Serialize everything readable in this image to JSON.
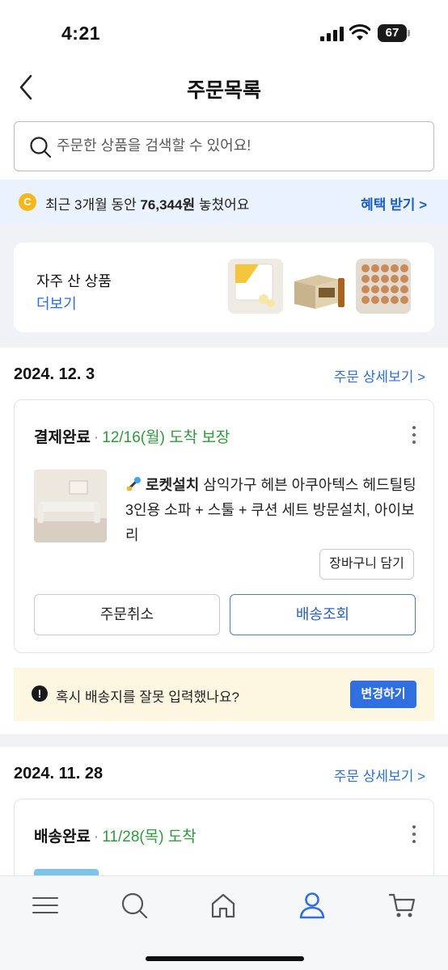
{
  "status_bar": {
    "time": "4:21",
    "battery": "67"
  },
  "header": {
    "title": "주문목록"
  },
  "search": {
    "placeholder": "주문한 상품을 검색할 수 있어요!"
  },
  "savings": {
    "coin_label": "C",
    "prefix": "최근 3개월 동안 ",
    "amount": "76,344원",
    "suffix": " 놓쳤어요",
    "link": "혜택 받기 >"
  },
  "frequent": {
    "title": "자주 산 상품",
    "more": "더보기"
  },
  "orders": [
    {
      "date": "2024. 12. 3",
      "detail_link": "주문 상세보기 >",
      "status": "결제완료",
      "delivery": "12/16(월) 도착 보장",
      "badge": "로켓설치",
      "product": "삼익가구 헤븐 아쿠아텍스 헤드틸팅 3인용 소파 + 스툴 + 쿠션 세트 방문설치, 아이보리",
      "cart_button": "장바구니 담기",
      "cancel_button": "주문취소",
      "track_button": "배송조회"
    },
    {
      "date": "2024. 11. 28",
      "detail_link": "주문 상세보기 >",
      "status": "배송완료",
      "delivery": "11/28(목) 도착"
    }
  ],
  "warning": {
    "icon": "!",
    "text": "혹시 배송지를 잘못 입력했나요?",
    "button": "변경하기"
  },
  "colors": {
    "accent": "#2f6fe0",
    "link": "#2a6fd6",
    "green": "#2f9a3c",
    "savings_bg": "#eaf3fd",
    "warning_bg": "#fdf7e2"
  },
  "nav_icons": [
    "menu-icon",
    "search-icon",
    "home-icon",
    "user-icon",
    "cart-icon"
  ]
}
